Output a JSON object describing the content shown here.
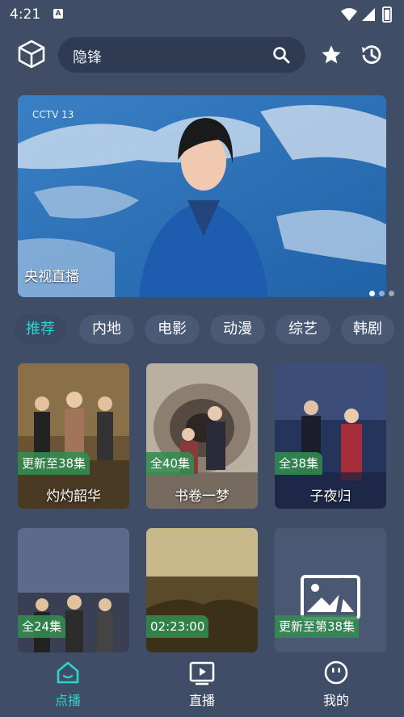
{
  "status_bar": {
    "time": "4:21",
    "notification_letter": "A"
  },
  "search": {
    "query": "隐锋"
  },
  "icons": {
    "logo": "cube-icon",
    "search": "search-icon",
    "favorites": "star-icon",
    "history": "history-icon"
  },
  "banner": {
    "title": "央视直播",
    "channel_logo": "CCTV 13",
    "page_count": 3,
    "active_page": 1
  },
  "categories": [
    "推荐",
    "内地",
    "电影",
    "动漫",
    "综艺",
    "韩剧"
  ],
  "active_category": "推荐",
  "cards": [
    {
      "title": "灼灼韶华",
      "badge": "更新至38集"
    },
    {
      "title": "书卷一梦",
      "badge": "全40集"
    },
    {
      "title": "子夜归",
      "badge": "全38集"
    },
    {
      "title": "",
      "badge": "全24集"
    },
    {
      "title": "",
      "badge": "02:23:00"
    },
    {
      "title": "",
      "badge": "更新至第38集"
    }
  ],
  "bottom_nav": [
    {
      "label": "点播",
      "icon": "home-icon",
      "active": true
    },
    {
      "label": "直播",
      "icon": "play-screen-icon",
      "active": false
    },
    {
      "label": "我的",
      "icon": "user-face-icon",
      "active": false
    }
  ],
  "colors": {
    "background": "#3f4d66",
    "accent": "#2cd4cf",
    "badge": "#328c50"
  }
}
